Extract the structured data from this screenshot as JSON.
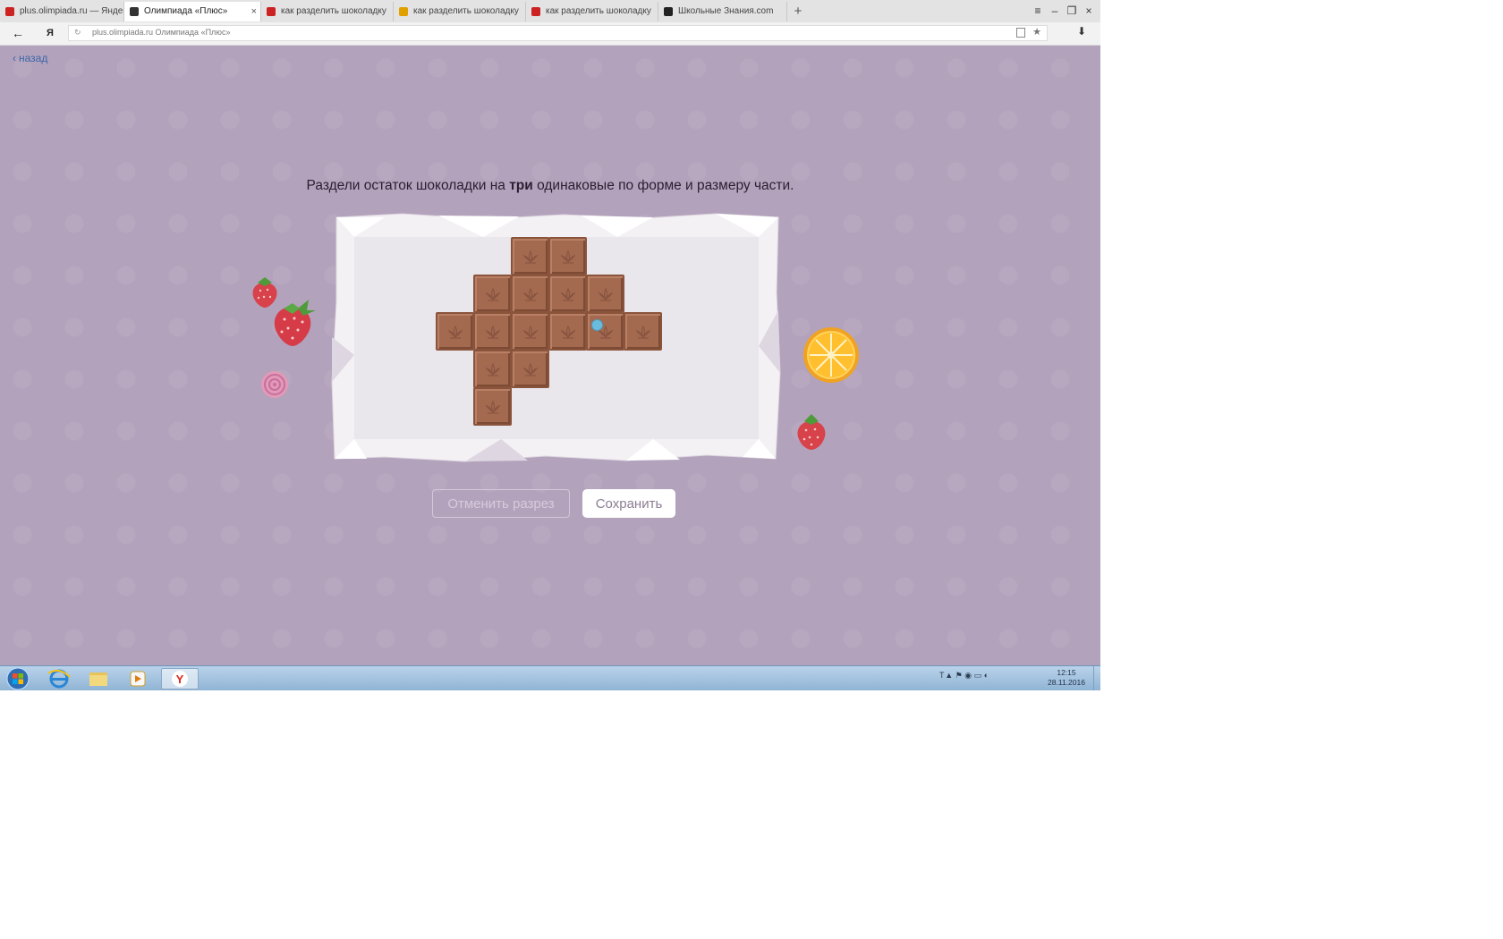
{
  "browser": {
    "tabs": [
      {
        "title": "plus.olimpiada.ru — Яндекс",
        "favicon_color": "#cc2222",
        "active": false
      },
      {
        "title": "Олимпиада «Плюс»",
        "favicon_color": "#333333",
        "active": true
      },
      {
        "title": "как разделить шоколадку",
        "favicon_color": "#cc2222",
        "active": false
      },
      {
        "title": "как разделить шоколадку",
        "favicon_color": "#e0a000",
        "active": false
      },
      {
        "title": "как разделить шоколадку",
        "favicon_color": "#cc2222",
        "active": false
      },
      {
        "title": "Школьные Знания.com",
        "favicon_color": "#222222",
        "active": false
      }
    ],
    "tab_close_glyph": "×",
    "new_tab_glyph": "+",
    "window_controls": [
      "≡",
      "–",
      "❐",
      "×"
    ],
    "address": {
      "url": "plus.olimpiada.ru  Олимпиада «Плюс»"
    },
    "back_glyph": "←",
    "yandex_glyph": "Я",
    "download_glyph": "⬇"
  },
  "page": {
    "back_link": "назад",
    "task": {
      "before": "Раздели остаток шоколадки на ",
      "bold": "три",
      "after": " одинаковые по форме и размеру части."
    },
    "buttons": {
      "cancel_cut": "Отменить разрез",
      "save": "Сохранить"
    },
    "chocolate": {
      "cell_size_units": 1,
      "cells": [
        [
          2,
          0
        ],
        [
          3,
          0
        ],
        [
          1,
          1
        ],
        [
          2,
          1
        ],
        [
          3,
          1
        ],
        [
          4,
          1
        ],
        [
          0,
          2
        ],
        [
          1,
          2
        ],
        [
          2,
          2
        ],
        [
          3,
          2
        ],
        [
          4,
          2
        ],
        [
          5,
          2
        ],
        [
          1,
          3
        ],
        [
          2,
          3
        ],
        [
          1,
          4
        ]
      ],
      "colors": {
        "fill": "#a36a50",
        "edge": "#8a543c",
        "leaf": "#8a5540"
      }
    },
    "decorations": [
      "strawberry-small",
      "strawberry-large",
      "candy",
      "orange-slice",
      "strawberry-right"
    ]
  },
  "taskbar": {
    "tray_glyphs": "Т ▲  ⚑ ◉ ▭ ◐",
    "time": "12:15",
    "date": "28.11.2016"
  }
}
